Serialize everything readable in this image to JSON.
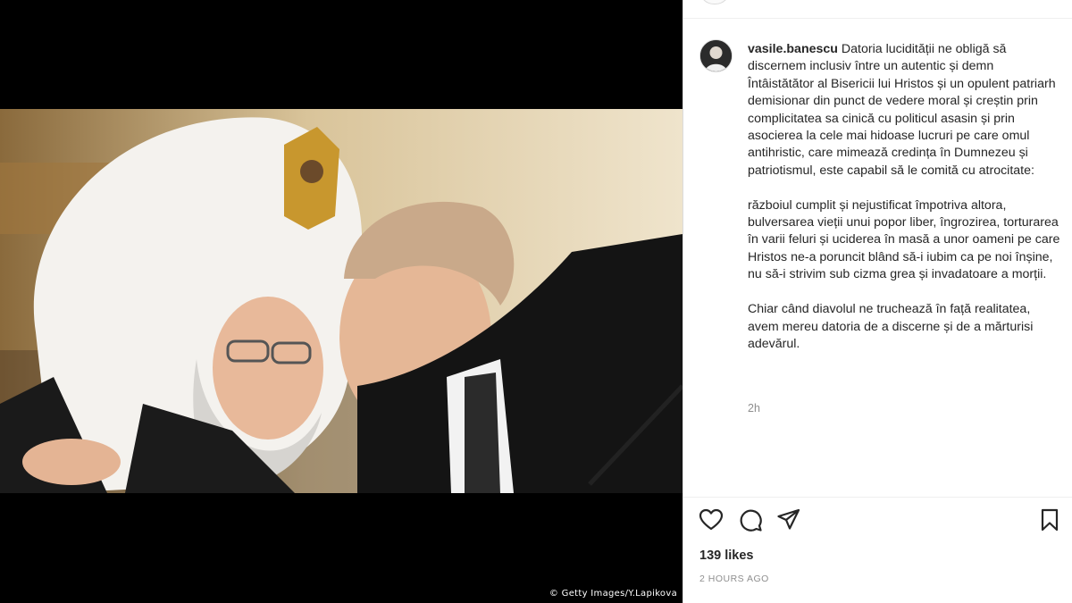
{
  "post": {
    "photo_credit": "© Getty Images/Y.Lapikova",
    "username": "vasile.banescu",
    "caption": " Datoria lucidității ne obligă să discernem inclusiv între un autentic și demn Întâistătător al Bisericii lui Hristos și un opulent patriarh demisionar din punct de vedere moral și creștin prin complicitatea sa cinică cu politicul asasin și prin asocierea la cele mai hidoase lucruri pe care omul antihristic, care mimează credința în Dumnezeu și patriotismul, este capabil să le comită cu atrocitate:\n\nrăzboiul cumplit și nejustificat împotriva altora, bulversarea vieții unui popor liber, îngrozirea, torturarea în varii feluri și uciderea în masă a unor oameni pe care Hristos ne-a poruncit blând să-i iubim ca pe noi înșine, nu să-i strivim sub cizma grea și invadatoare a morții.\n\nChiar când diavolul ne truchează în față realitatea, avem mereu datoria de a discerne și de a mărturisi adevărul.",
    "comment_time": "2h",
    "likes": "139 likes",
    "posted_ago": "2 HOURS AGO"
  },
  "icons": {
    "like": "heart-icon",
    "comment": "comment-bubble-icon",
    "share": "paper-plane-icon",
    "save": "bookmark-icon"
  }
}
